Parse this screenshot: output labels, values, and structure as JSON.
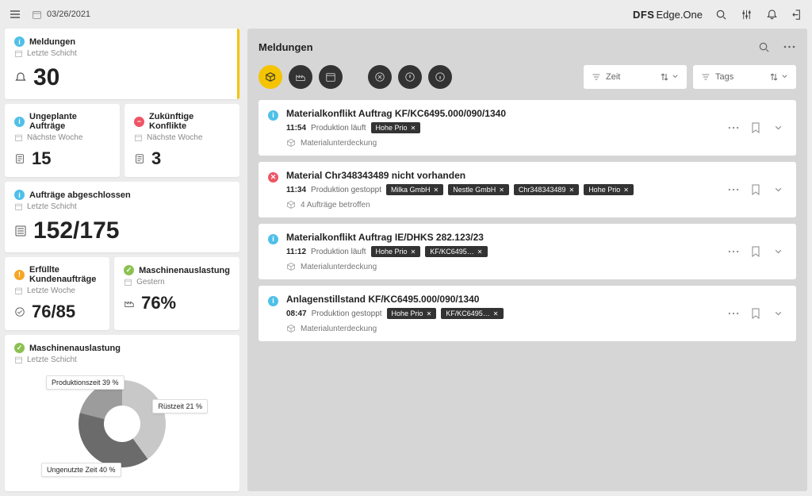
{
  "top": {
    "date": "03/26/2021",
    "brand1": "DFS",
    "brand2": "Edge.One"
  },
  "cards": {
    "meldungen": {
      "title": "Meldungen",
      "sub": "Letzte Schicht",
      "value": "30"
    },
    "ungeplante": {
      "title": "Ungeplante Aufträge",
      "sub": "Nächste Woche",
      "value": "15"
    },
    "konflikte": {
      "title": "Zukünftige Konflikte",
      "sub": "Nächste Woche",
      "value": "3"
    },
    "abgeschlossen": {
      "title": "Aufträge abgeschlossen",
      "sub": "Letzte Schicht",
      "value": "152/175"
    },
    "kunden": {
      "title": "Erfüllte Kundenaufträge",
      "sub": "Letzte Woche",
      "value": "76/85"
    },
    "ausl": {
      "title": "Maschinenauslastung",
      "sub": "Gestern",
      "value": "76%"
    },
    "ausl2": {
      "title": "Maschinenauslastung",
      "sub": "Letzte Schicht"
    }
  },
  "chart_data": {
    "type": "pie",
    "title": "Maschinenauslastung",
    "slices": [
      {
        "label": "Ungenutzte Zeit",
        "percent": 40
      },
      {
        "label": "Produktionszeit",
        "percent": 39
      },
      {
        "label": "Rüstzeit",
        "percent": 21
      }
    ],
    "labels": {
      "prod": "Produktionszeit\n39 %",
      "ruest": "Rüstzeit\n21 %",
      "unused": "Ungenutzte Zeit\n40 %"
    }
  },
  "main": {
    "title": "Meldungen",
    "dd": {
      "zeit": "Zeit",
      "tags": "Tags"
    }
  },
  "msgs": [
    {
      "icon": "info",
      "title": "Materialkonflikt Auftrag KF/KC6495.000/090/1340",
      "time": "11:54",
      "status": "Produktion läuft",
      "tags": [
        "Hohe Prio"
      ],
      "foot": "Materialunterdeckung"
    },
    {
      "icon": "err",
      "title": "Material Chr348343489 nicht vorhanden",
      "time": "11:34",
      "status": "Produktion gestoppt",
      "tags": [
        "Milka GmbH",
        "Nestle GmbH",
        "Chr348343489",
        "Hohe Prio"
      ],
      "foot": "4 Aufträge betroffen"
    },
    {
      "icon": "info",
      "title": "Materialkonflikt Auftrag IE/DHKS 282.123/23",
      "time": "11:12",
      "status": "Produktion läuft",
      "tags": [
        "Hohe Prio",
        "KF/KC6495…"
      ],
      "foot": "Materialunterdeckung"
    },
    {
      "icon": "info",
      "title": "Anlagenstillstand KF/KC6495.000/090/1340",
      "time": "08:47",
      "status": "Produktion gestoppt",
      "tags": [
        "Hohe Prio",
        "KF/KC6495…"
      ],
      "foot": "Materialunterdeckung"
    }
  ]
}
